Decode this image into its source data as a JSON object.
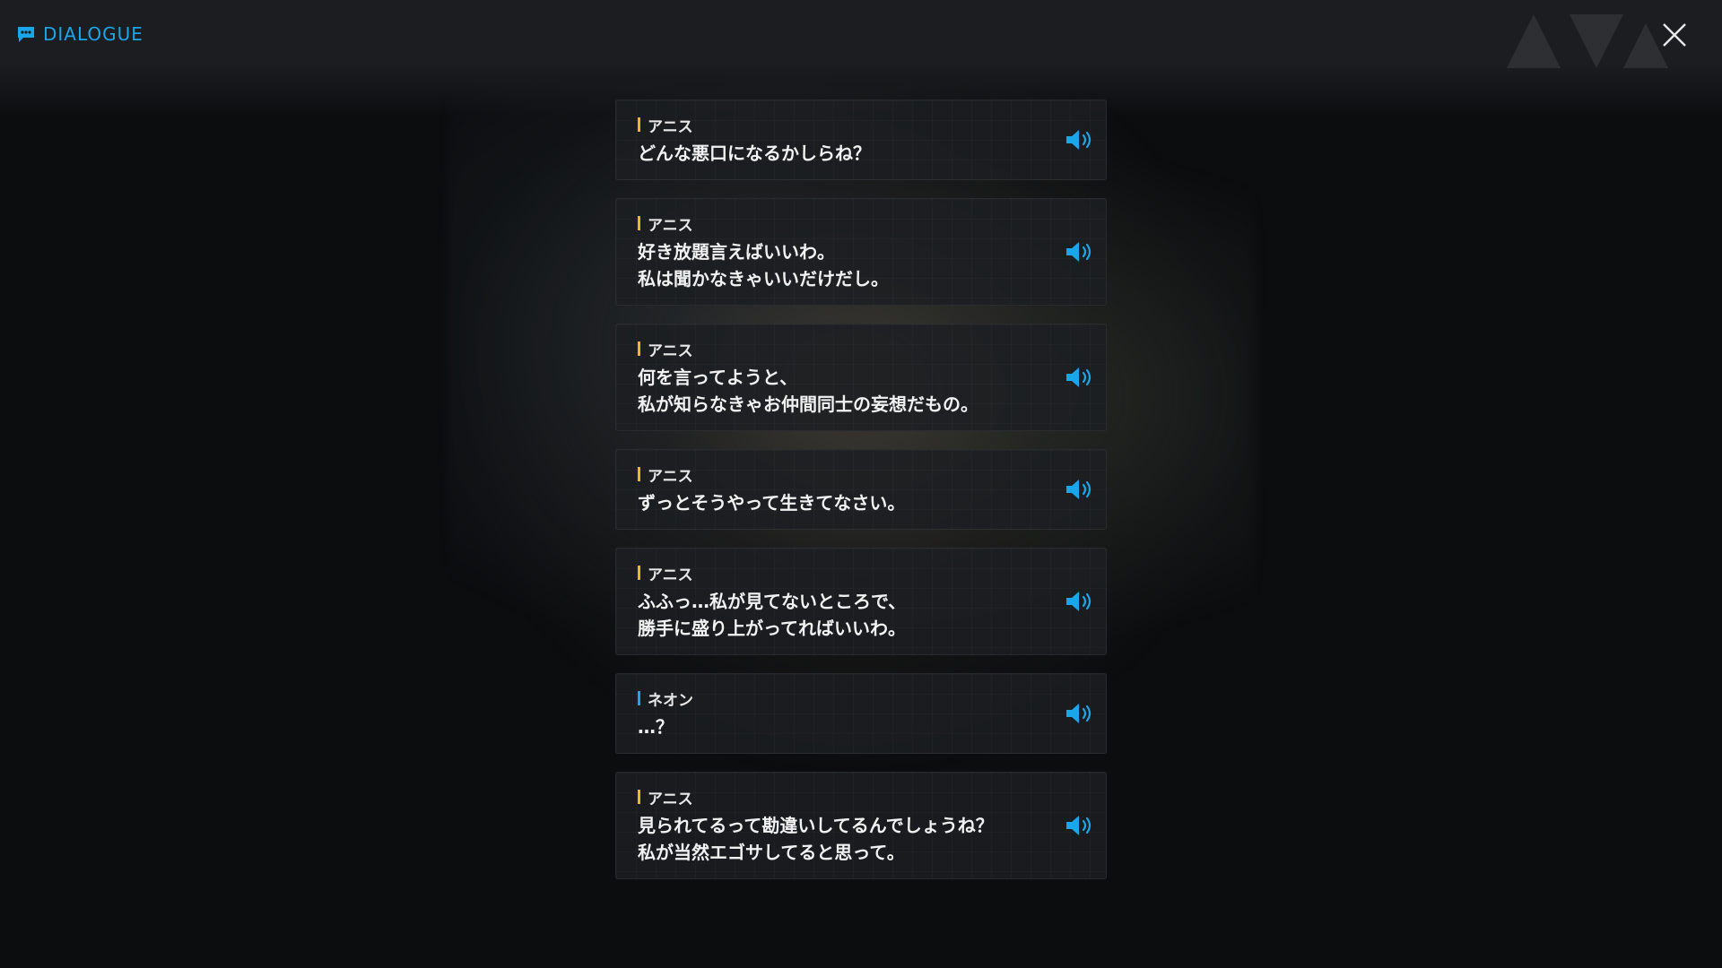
{
  "header": {
    "title": "DIALOGUE",
    "icon": "chat-bubble-icon",
    "accent_color": "#1aa6ea"
  },
  "close": {
    "icon": "close-icon"
  },
  "speaker_colors": {
    "default": "#f0b428",
    "alt": "#1aa6ea"
  },
  "dialogue": [
    {
      "speaker": "アニス",
      "text": "どんな悪口になるかしらね？"
    },
    {
      "speaker": "アニス",
      "text": "好き放題言えばいいわ。\n私は聞かなきゃいいだけだし。"
    },
    {
      "speaker": "アニス",
      "text": "何を言ってようと、\n私が知らなきゃお仲間同士の妄想だもの。"
    },
    {
      "speaker": "アニス",
      "text": "ずっとそうやって生きてなさい。"
    },
    {
      "speaker": "アニス",
      "text": "ふふっ…私が見てないところで、\n勝手に盛り上がってればいいわ。"
    },
    {
      "speaker": "ネオン",
      "text": "…？"
    },
    {
      "speaker": "アニス",
      "text": "見られてるって勘違いしてるんでしょうね？\n私が当然エゴサしてると思って。"
    }
  ]
}
